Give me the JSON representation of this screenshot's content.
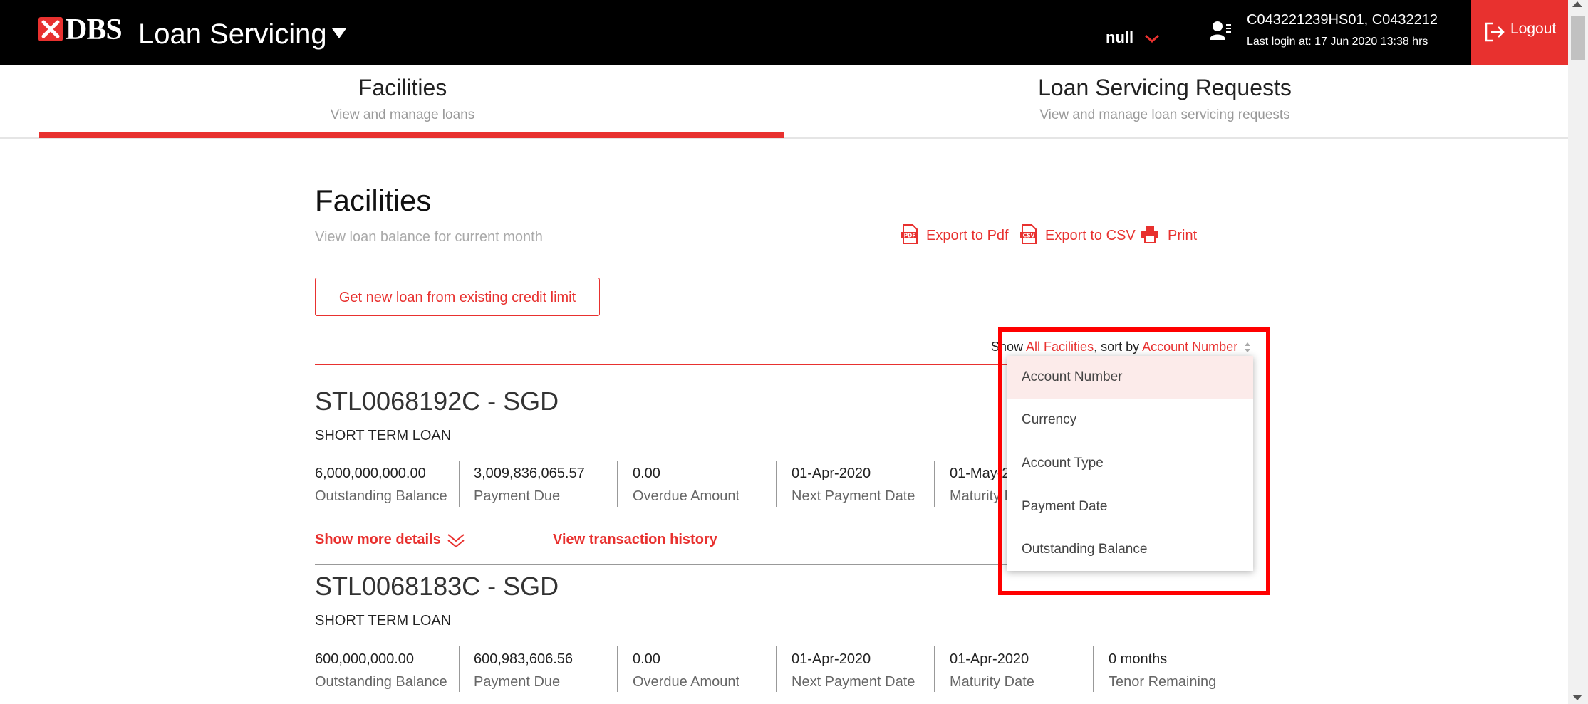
{
  "header": {
    "logo_text": "DBS",
    "app_title": "Loan Servicing",
    "null_label": "null",
    "user_ids": "C043221239HS01, C0432212",
    "last_login": "Last login at: 17 Jun 2020 13:38 hrs",
    "logout_label": "Logout",
    "brand_color": "#e8312f"
  },
  "tabs": [
    {
      "title": "Facilities",
      "subtitle": "View and manage loans",
      "active": true
    },
    {
      "title": "Loan Servicing Requests",
      "subtitle": "View and manage loan servicing requests",
      "active": false
    }
  ],
  "page": {
    "title": "Facilities",
    "subtitle": "View loan balance for current month",
    "export_pdf": "Export to Pdf",
    "export_csv": "Export to CSV",
    "print": "Print",
    "new_loan_button": "Get new loan from existing credit limit"
  },
  "sort": {
    "show_prefix": "Show",
    "filter_value": "All Facilities",
    "sort_prefix": ", sort by",
    "sort_value": "Account Number",
    "options": [
      "Account Number",
      "Currency",
      "Account Type",
      "Payment Date",
      "Outstanding Balance"
    ],
    "selected": "Account Number"
  },
  "facilities": [
    {
      "title": "STL0068192C - SGD",
      "type": "SHORT TERM LOAN",
      "metrics": [
        {
          "value": "6,000,000,000.00",
          "label": "Outstanding Balance"
        },
        {
          "value": "3,009,836,065.57",
          "label": "Payment Due"
        },
        {
          "value": "0.00",
          "label": "Overdue Amount"
        },
        {
          "value": "01-Apr-2020",
          "label": "Next Payment Date"
        },
        {
          "value": "01-May-2",
          "label": "Maturity D"
        }
      ],
      "show_more": "Show more details",
      "view_history": "View transaction history"
    },
    {
      "title": "STL0068183C - SGD",
      "type": "SHORT TERM LOAN",
      "metrics": [
        {
          "value": "600,000,000.00",
          "label": "Outstanding Balance"
        },
        {
          "value": "600,983,606.56",
          "label": "Payment Due"
        },
        {
          "value": "0.00",
          "label": "Overdue Amount"
        },
        {
          "value": "01-Apr-2020",
          "label": "Next Payment Date"
        },
        {
          "value": "01-Apr-2020",
          "label": "Maturity Date"
        },
        {
          "value": "0 months",
          "label": "Tenor Remaining"
        }
      ]
    }
  ]
}
